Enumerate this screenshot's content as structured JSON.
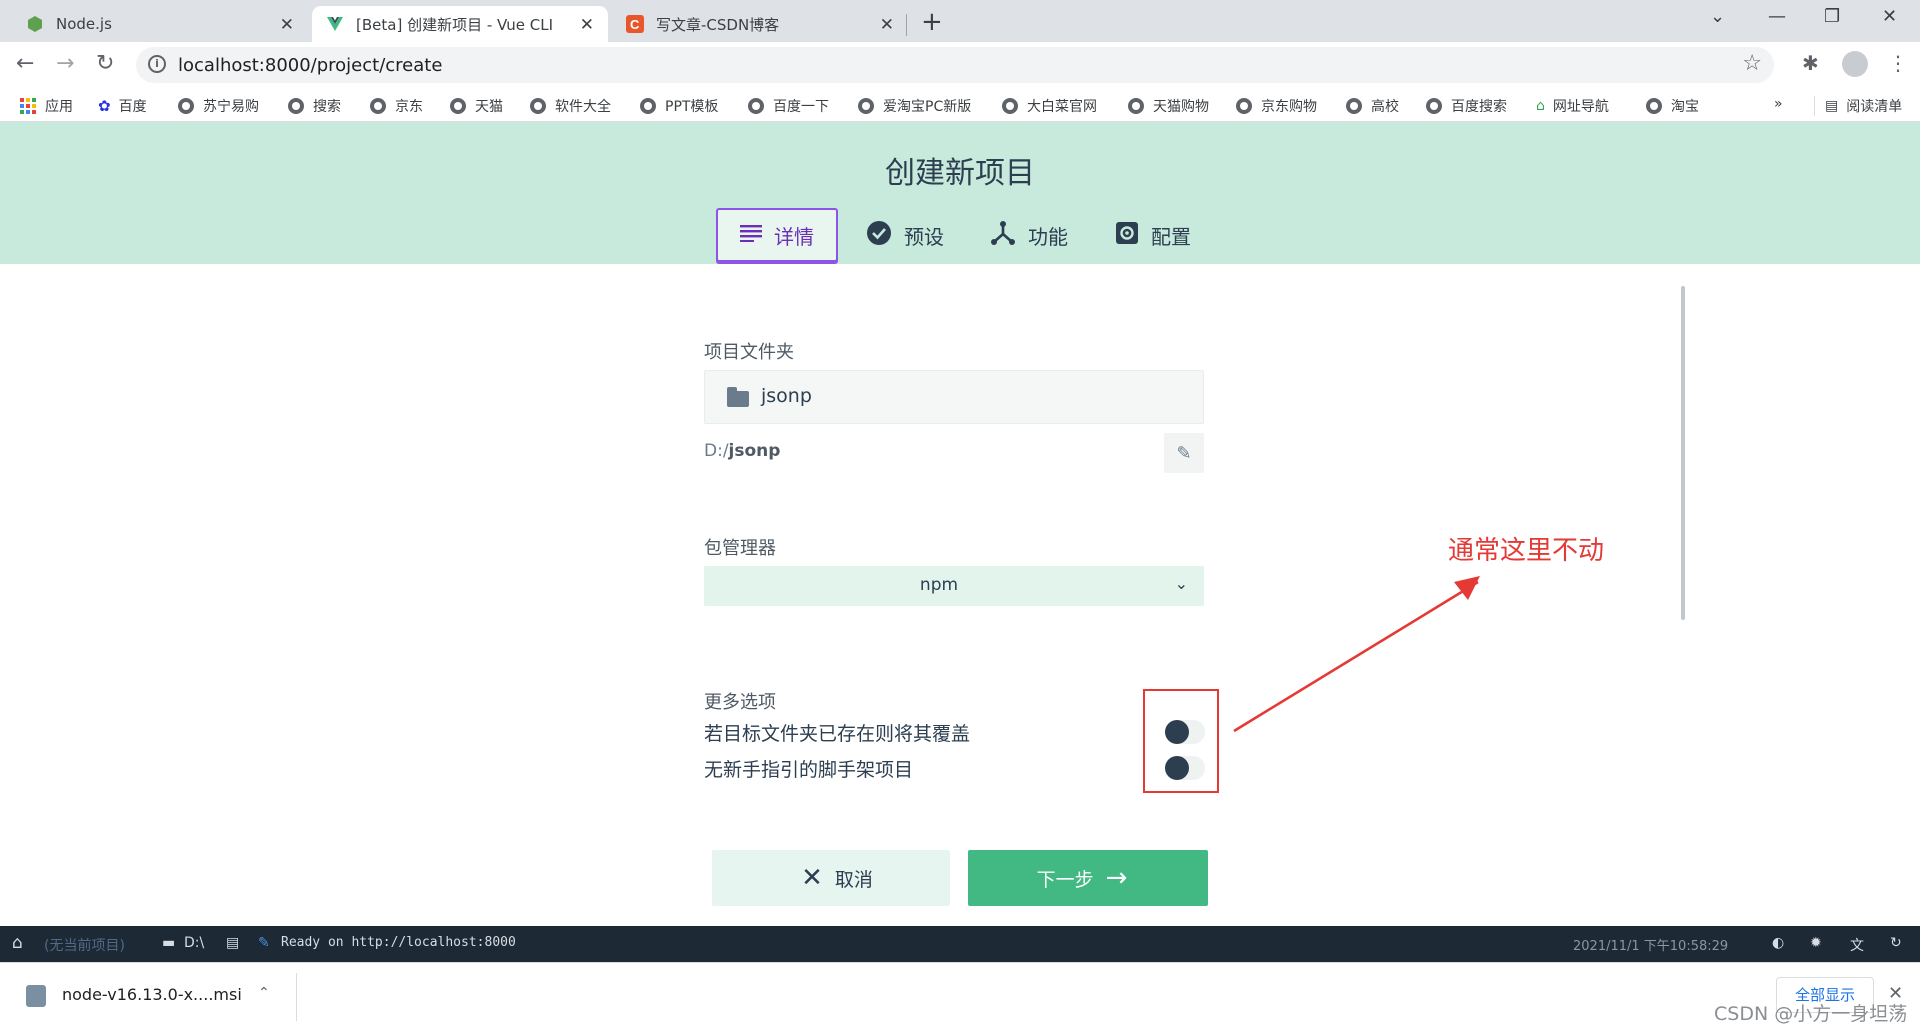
{
  "browser": {
    "tabs": [
      {
        "title": "Node.js",
        "favicon": "nodejs-icon",
        "active": false
      },
      {
        "title": "[Beta] 创建新项目 - Vue CLI",
        "favicon": "vue-icon",
        "active": true
      },
      {
        "title": "写文章-CSDN博客",
        "favicon": "csdn-icon",
        "active": false
      }
    ],
    "new_tab_glyph": "+",
    "url": "localhost:8000/project/create",
    "bookmarks": [
      "应用",
      "百度",
      "苏宁易购",
      "搜索",
      "京东",
      "天猫",
      "软件大全",
      "PPT模板",
      "百度一下",
      "爱淘宝PC新版",
      "大白菜官网",
      "天猫购物",
      "京东购物",
      "高校",
      "百度搜索",
      "网址导航",
      "淘宝"
    ],
    "bookmarks_overflow": "»",
    "reading_list": "阅读清单"
  },
  "page": {
    "title": "创建新项目",
    "steps": [
      {
        "label": "详情",
        "icon": "list-icon",
        "active": true
      },
      {
        "label": "预设",
        "icon": "check-circle-icon",
        "active": false
      },
      {
        "label": "功能",
        "icon": "fork-icon",
        "active": false
      },
      {
        "label": "配置",
        "icon": "settings-icon",
        "active": false
      }
    ],
    "folder_label": "项目文件夹",
    "folder_name": "jsonp",
    "path_prefix": "D:/",
    "path_name": "jsonp",
    "package_manager_label": "包管理器",
    "package_manager_value": "npm",
    "more_options_label": "更多选项",
    "options": [
      {
        "label": "若目标文件夹已存在则将其覆盖",
        "enabled": false
      },
      {
        "label": "无新手指引的脚手架项目",
        "enabled": false
      }
    ],
    "cancel_label": "取消",
    "next_label": "下一步",
    "annotation": "通常这里不动",
    "annotation_color": "#e53935"
  },
  "status_bar": {
    "project": "(无当前项目)",
    "drive": "D:\\",
    "message": "Ready on http://localhost:8000",
    "datetime": "2021/11/1  下午10:58:29"
  },
  "download_shelf": {
    "file": "node-v16.13.0-x....msi",
    "show_all": "全部显示",
    "watermark": "CSDN @小方一身坦荡"
  },
  "colors": {
    "header_bg": "#c8eadc",
    "accent_green": "#42b883",
    "active_step": "#8e54e9",
    "dark": "#2c3e50"
  }
}
